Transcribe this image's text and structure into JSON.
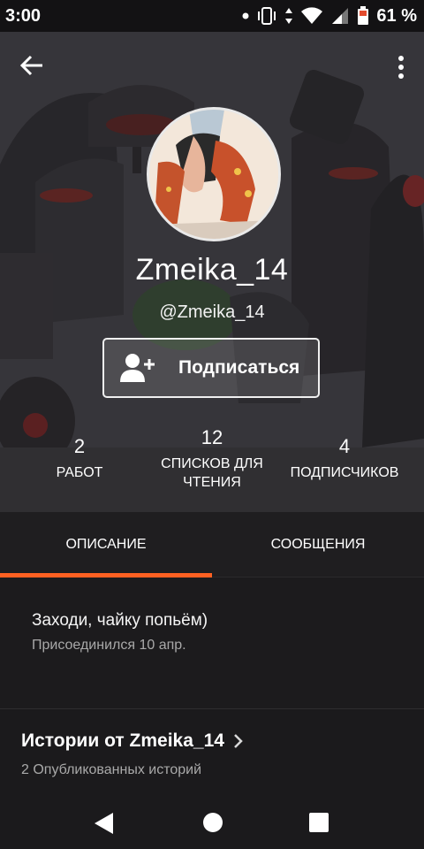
{
  "status": {
    "time": "3:00",
    "battery": "61 %"
  },
  "profile": {
    "display_name": "Zmeika_14",
    "handle": "@Zmeika_14",
    "follow_label": "Подписаться"
  },
  "stats": [
    {
      "value": "2",
      "label": "РАБОТ"
    },
    {
      "value": "12",
      "label": "СПИСКОВ ДЛЯ ЧТЕНИЯ"
    },
    {
      "value": "4",
      "label": "ПОДПИСЧИКОВ"
    }
  ],
  "tabs": {
    "description": "ОПИСАНИЕ",
    "messages": "СООБЩЕНИЯ",
    "active": "description"
  },
  "about": {
    "text": "Заходи, чайку попьём)",
    "joined": "Присоединился 10 апр."
  },
  "stories": {
    "title": "Истории от Zmeika_14",
    "count": "2 Опубликованных историй"
  },
  "colors": {
    "accent": "#ff6122",
    "background": "#1b1a1c"
  },
  "icons": [
    "back-arrow-icon",
    "more-vertical-icon",
    "add-user-icon",
    "chevron-right-icon",
    "nav-back-icon",
    "nav-home-icon",
    "nav-recent-icon"
  ]
}
